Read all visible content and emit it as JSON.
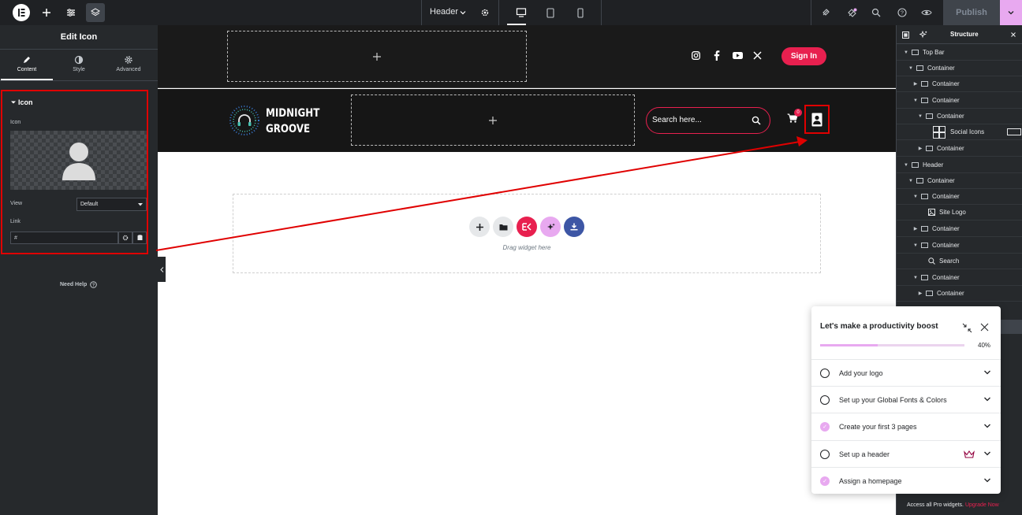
{
  "topbar": {
    "page_label": "Header",
    "publish_label": "Publish"
  },
  "left_panel": {
    "title": "Edit Icon",
    "tabs": [
      {
        "label": "Content"
      },
      {
        "label": "Style"
      },
      {
        "label": "Advanced"
      }
    ],
    "section_title": "Icon",
    "icon_label": "Icon",
    "view_label": "View",
    "view_value": "Default",
    "link_label": "Link",
    "link_value": "#",
    "need_help": "Need Help"
  },
  "canvas": {
    "sign_in": "Sign In",
    "logo_line1": "MIDNIGHT",
    "logo_line2": "GROOVE",
    "search_placeholder": "Search here...",
    "cart_count": "0",
    "drag_widget": "Drag widget here"
  },
  "structure": {
    "title": "Structure",
    "items": [
      {
        "label": "Top Bar"
      },
      {
        "label": "Container"
      },
      {
        "label": "Container"
      },
      {
        "label": "Container"
      },
      {
        "label": "Container"
      },
      {
        "label": "Social Icons"
      },
      {
        "label": "Container"
      },
      {
        "label": "Header"
      },
      {
        "label": "Container"
      },
      {
        "label": "Container"
      },
      {
        "label": "Site Logo"
      },
      {
        "label": "Container"
      },
      {
        "label": "Container"
      },
      {
        "label": "Search"
      },
      {
        "label": "Container"
      },
      {
        "label": "Container"
      }
    ],
    "footer_text": "Access all Pro widgets.",
    "footer_link": "Upgrade Now"
  },
  "checklist": {
    "title": "Let's make a productivity boost",
    "progress_percent": "40%",
    "progress_value": 0.4,
    "items": [
      {
        "label": "Add your logo",
        "done": false
      },
      {
        "label": "Set up your Global Fonts & Colors",
        "done": false
      },
      {
        "label": "Create your first 3 pages",
        "done": true
      },
      {
        "label": "Set up a header",
        "done": false
      },
      {
        "label": "Assign a homepage",
        "done": true
      }
    ]
  },
  "colors": {
    "accent_pink": "#e8204f",
    "pro_pink": "#e8a9f0",
    "annotation_red": "#e00000"
  }
}
